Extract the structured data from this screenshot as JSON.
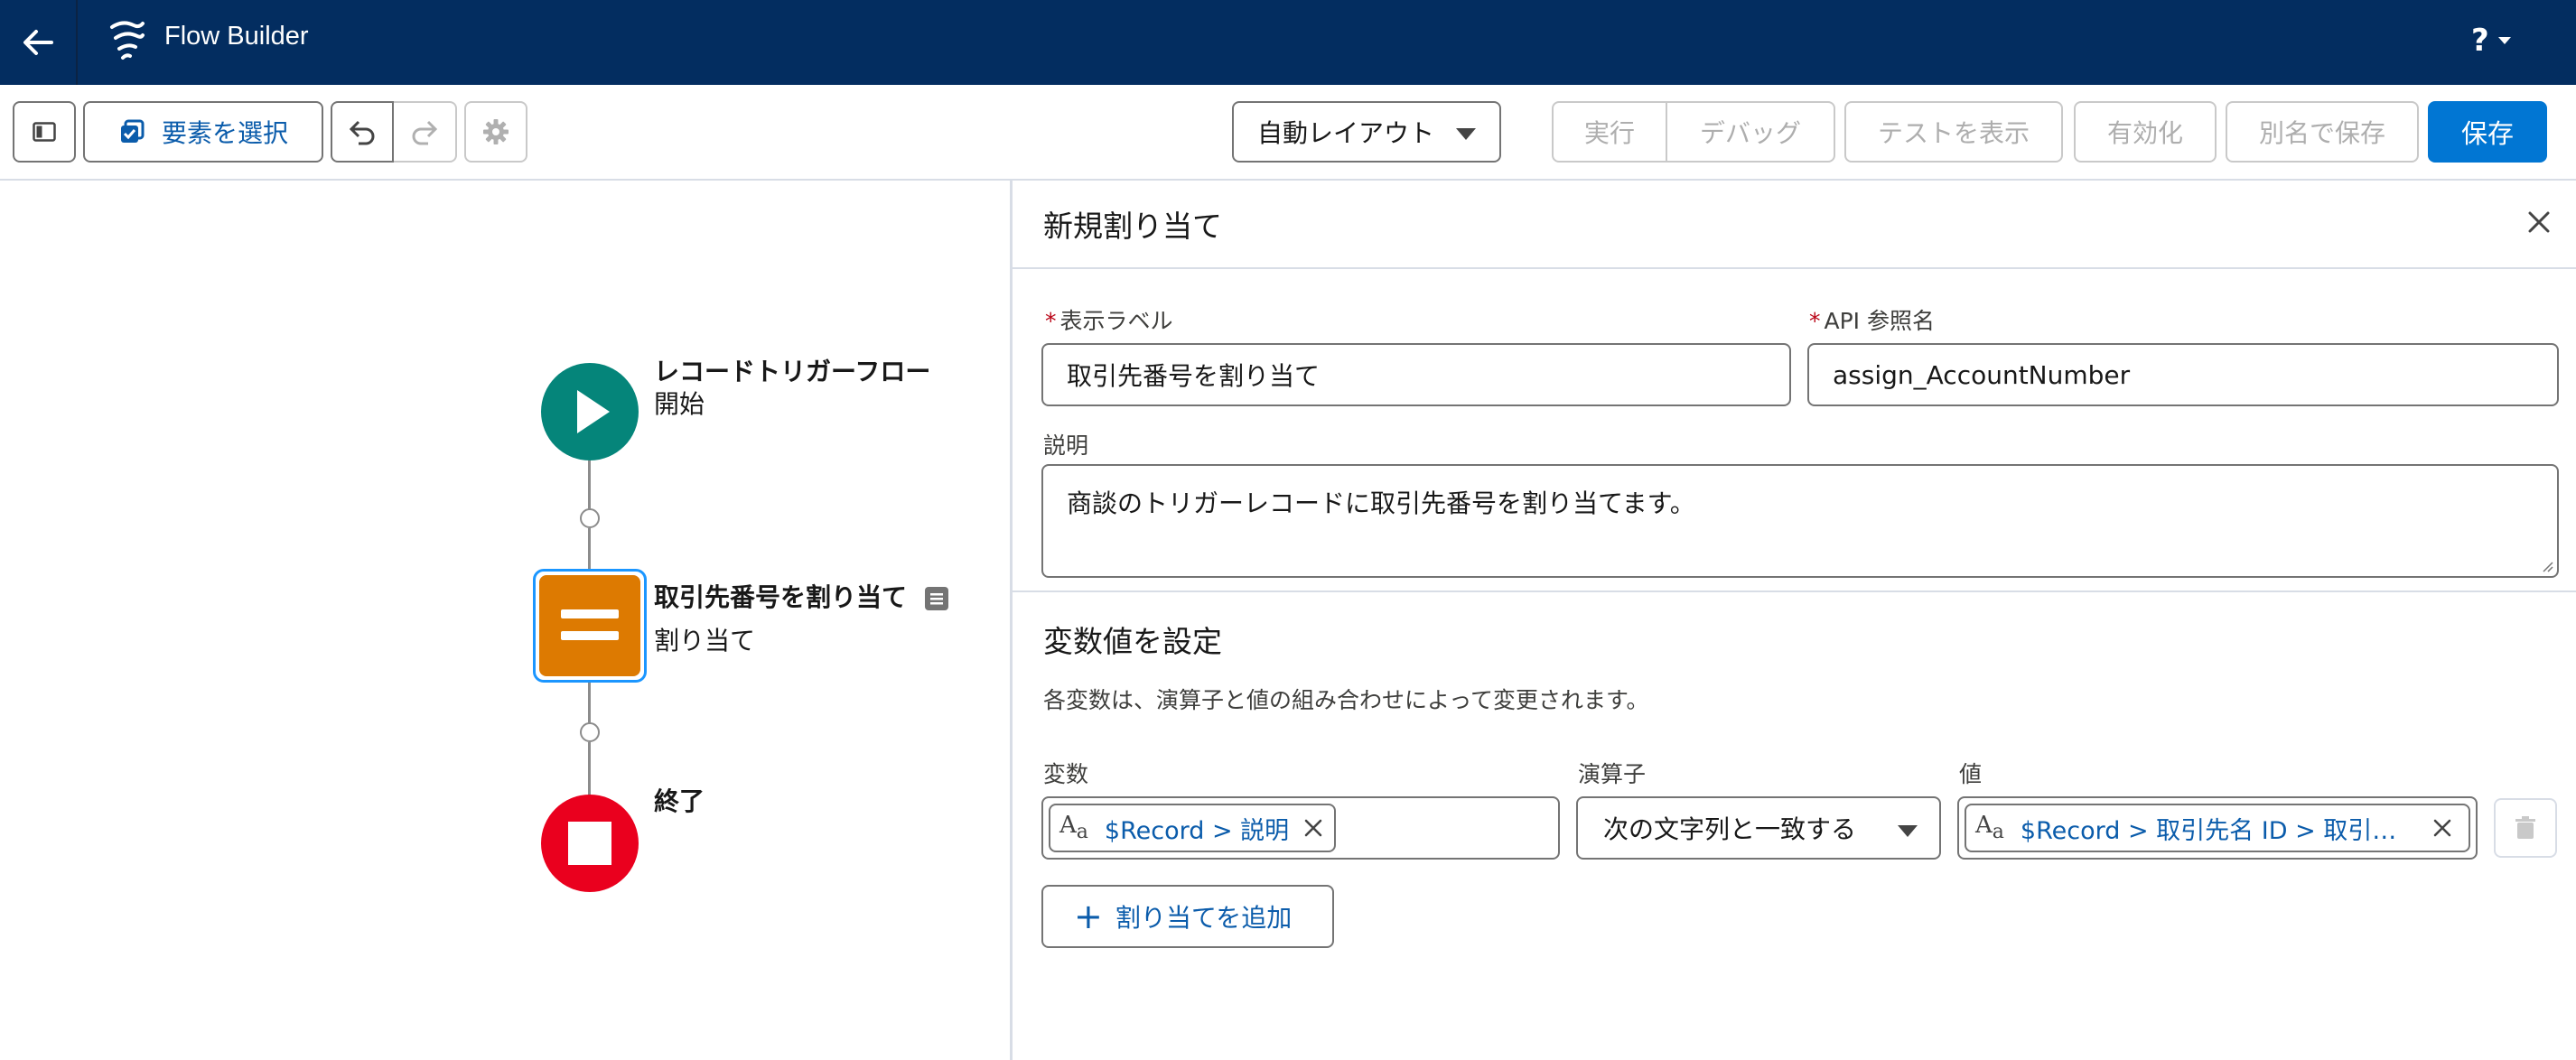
{
  "header": {
    "app_title": "Flow Builder",
    "help_label": "?"
  },
  "toolbar": {
    "select_elements_label": "要素を選択",
    "layout_value": "自動レイアウト",
    "run_label": "実行",
    "debug_label": "デバッグ",
    "show_tests_label": "テストを表示",
    "activate_label": "有効化",
    "save_as_label": "別名で保存",
    "save_label": "保存"
  },
  "canvas": {
    "start_node": {
      "title": "レコードトリガーフロー",
      "subtitle": "開始"
    },
    "assignment_node": {
      "title": "取引先番号を割り当て",
      "subtitle": "割り当て"
    },
    "end_node": {
      "title": "終了"
    },
    "colors": {
      "start": "#05857a",
      "assignment": "#dd7a01",
      "end": "#ea001e"
    }
  },
  "panel": {
    "title": "新規割り当て",
    "label_field": {
      "label": "表示ラベル",
      "value": "取引先番号を割り当て"
    },
    "api_field": {
      "label": "API 参照名",
      "value": "assign_AccountNumber"
    },
    "description_field": {
      "label": "説明",
      "value": "商談のトリガーレコードに取引先番号を割り当てます。"
    },
    "section": {
      "title": "変数値を設定",
      "help": "各変数は、演算子と値の組み合わせによって変更されます。",
      "variable_header": "変数",
      "operator_header": "演算子",
      "value_header": "値",
      "rows": [
        {
          "variable": "$Record > 説明",
          "operator": "次の文字列と一致する",
          "value": "$Record > 取引先名 ID > 取引先..."
        }
      ],
      "add_label": "割り当てを追加"
    }
  },
  "colors": {
    "header_bg": "#032d60",
    "brand": "#0176d3",
    "link": "#0b5cab"
  }
}
